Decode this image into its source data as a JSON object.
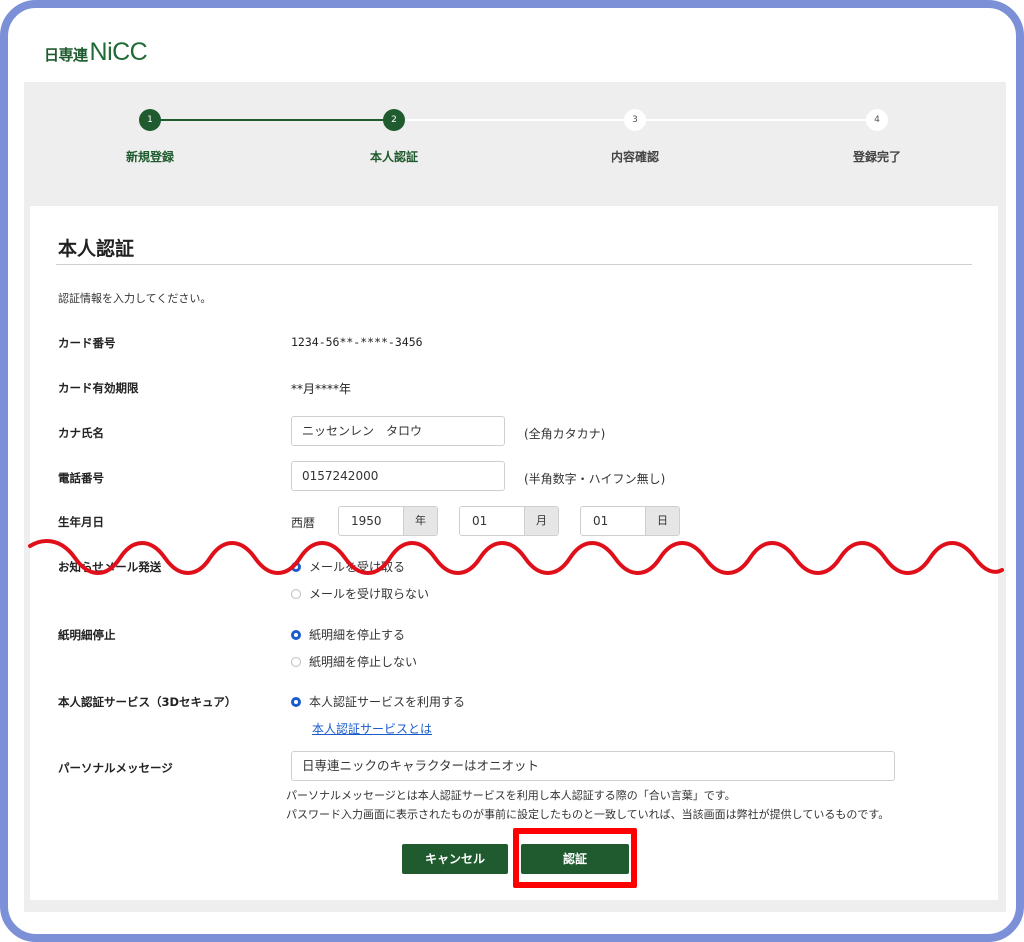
{
  "logo": {
    "kanji": "日専連",
    "brand": "NiCC"
  },
  "stepper": {
    "steps": [
      {
        "number": "1",
        "label": "新規登録"
      },
      {
        "number": "2",
        "label": "本人認証"
      },
      {
        "number": "3",
        "label": "内容確認"
      },
      {
        "number": "4",
        "label": "登録完了"
      }
    ],
    "current_step": 2
  },
  "form": {
    "title": "本人認証",
    "intro": "認証情報を入力してください。",
    "card_number": {
      "label": "カード番号",
      "value": "1234-56**-****-3456"
    },
    "card_expiry": {
      "label": "カード有効期限",
      "value": "**月****年"
    },
    "kana_name": {
      "label": "カナ氏名",
      "value": "ニッセンレン　タロウ",
      "hint": "(全角カタカナ)"
    },
    "phone": {
      "label": "電話番号",
      "value": "0157242000",
      "hint": "(半角数字・ハイフン無し)"
    },
    "birth": {
      "label": "生年月日",
      "era": "西暦",
      "year": "1950",
      "year_unit": "年",
      "month": "01",
      "month_unit": "月",
      "day": "01",
      "day_unit": "日"
    },
    "mail": {
      "label": "お知らせメール発送",
      "options": [
        "メールを受け取る",
        "メールを受け取らない"
      ],
      "selected": 0
    },
    "paper_statement": {
      "label": "紙明細停止",
      "options": [
        "紙明細を停止する",
        "紙明細を停止しない"
      ],
      "selected": 0
    },
    "auth_service": {
      "label": "本人認証サービス（3Dセキュア）",
      "option": "本人認証サービスを利用する",
      "link": "本人認証サービスとは"
    },
    "personal_message": {
      "label": "パーソナルメッセージ",
      "value": "日専連ニックのキャラクターはオニオット",
      "note1": "パーソナルメッセージとは本人認証サービスを利用し本人認証する際の「合い言葉」です。",
      "note2": "パスワード入力画面に表示されたものが事前に設定したものと一致していれば、当該画面は弊社が提供しているものです。"
    }
  },
  "buttons": {
    "cancel": "キャンセル",
    "submit": "認証"
  },
  "colors": {
    "frame": "#7b90d6",
    "brand_green": "#1f5b2e",
    "highlight": "#ff0000",
    "radio_blue": "#1a5ccc",
    "wave": "#e0101a"
  }
}
